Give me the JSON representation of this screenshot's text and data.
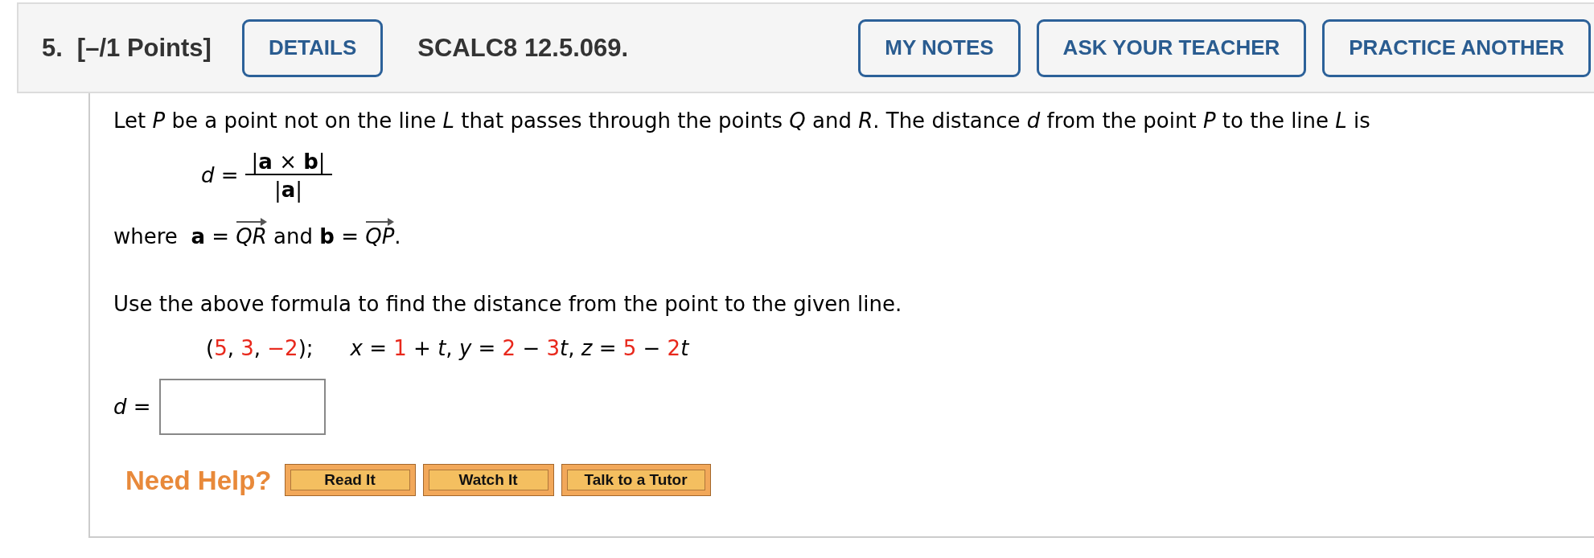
{
  "question": {
    "number": "5.",
    "points": "[–/1 Points]",
    "details_button": "DETAILS",
    "code": "SCALC8 12.5.069.",
    "actions": [
      "MY NOTES",
      "ASK YOUR TEACHER",
      "PRACTICE ANOTHER"
    ]
  },
  "body": {
    "intro": "Let *P* be a point not on the line *L* that passes through the points *Q* and *R*. The distance *d* from the point *P* to the line *L* is",
    "formula": {
      "lhs": "*d* =",
      "numerator": "|**a** × **b**|",
      "denominator": "|**a**|"
    },
    "definition": [
      {
        "kind": "text",
        "text": "where  **a** = "
      },
      {
        "kind": "vector",
        "text": "*QR*"
      },
      {
        "kind": "text",
        "text": " and **b** = "
      },
      {
        "kind": "vector",
        "text": "*QP*"
      },
      {
        "kind": "text",
        "text": "."
      }
    ],
    "instruction": "Use the above formula to find the distance from the point to the given line.",
    "point": [
      {
        "kind": "text",
        "text": "("
      },
      {
        "kind": "value",
        "text": "5"
      },
      {
        "kind": "text",
        "text": ", "
      },
      {
        "kind": "value",
        "text": "3"
      },
      {
        "kind": "text",
        "text": ", "
      },
      {
        "kind": "value",
        "text": "−2"
      },
      {
        "kind": "text",
        "text": ");"
      }
    ],
    "line": [
      {
        "kind": "text",
        "text": "*x* = "
      },
      {
        "kind": "value",
        "text": "1"
      },
      {
        "kind": "text",
        "text": " + *t*, *y* = "
      },
      {
        "kind": "value",
        "text": "2"
      },
      {
        "kind": "text",
        "text": " − "
      },
      {
        "kind": "value",
        "text": "3"
      },
      {
        "kind": "text",
        "text": "*t*, *z* = "
      },
      {
        "kind": "value",
        "text": "5"
      },
      {
        "kind": "text",
        "text": " − "
      },
      {
        "kind": "value",
        "text": "2"
      },
      {
        "kind": "text",
        "text": "*t*"
      }
    ],
    "answer": {
      "label": "*d* ="
    }
  },
  "help": {
    "label": "Need Help?",
    "buttons": [
      "Read It",
      "Watch It",
      "Talk to a Tutor"
    ]
  }
}
